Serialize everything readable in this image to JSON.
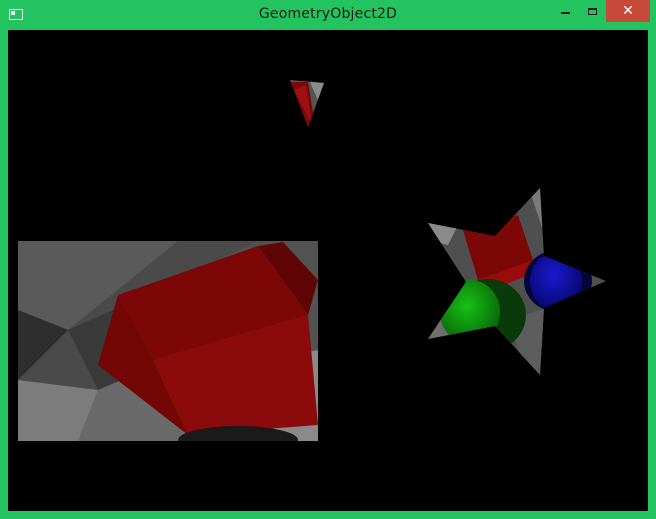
{
  "window": {
    "title": "GeometryObject2D",
    "controls": {
      "minimize": "minimize",
      "maximize": "maximize",
      "close": "✕"
    }
  },
  "colors": {
    "title_bar": "#23c45f",
    "close_button": "#c7493a",
    "viewport_bg": "#000000",
    "red_object": "#8b0a0a",
    "green_object": "#0aa00a",
    "blue_object": "#0a0aa8",
    "checker_light": "#9a9a9a",
    "checker_dark": "#3a3a3a"
  }
}
